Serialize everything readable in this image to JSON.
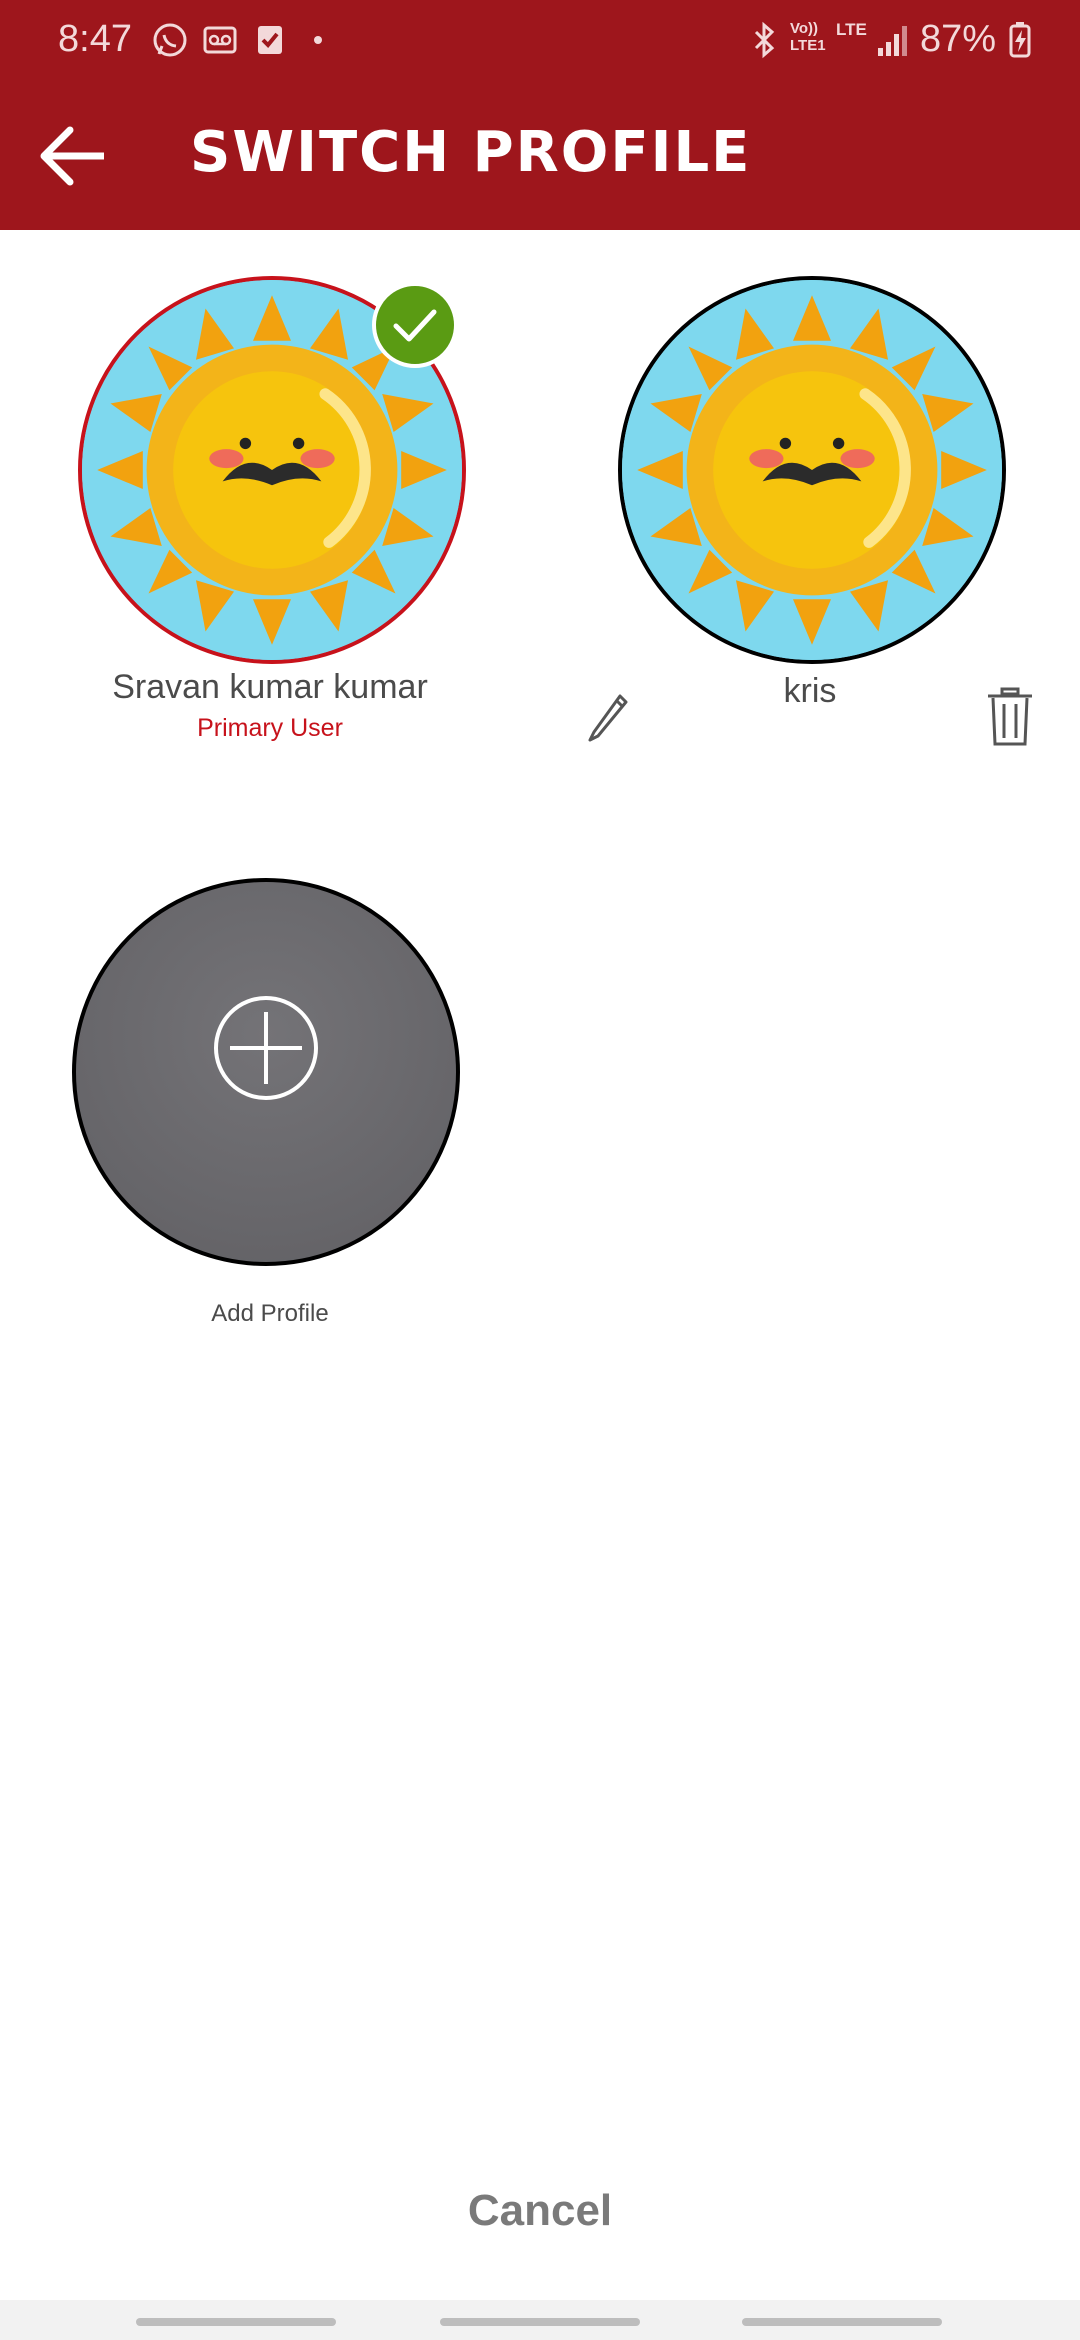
{
  "status_bar": {
    "time": "8:47",
    "battery": "87%",
    "icons": [
      "whatsapp-icon",
      "voicemail-icon",
      "task-check-icon",
      "bluetooth-icon",
      "volte-icon",
      "lte-icon",
      "signal-icon",
      "battery-charging-icon"
    ],
    "volte_text": "Vo)) LTE1",
    "lte_text": "LTE"
  },
  "header": {
    "title": "SWITCH PROFILE",
    "back_icon": "arrow-back-icon"
  },
  "profiles": [
    {
      "name": "Sravan kumar kumar",
      "role": "Primary User",
      "selected": true
    },
    {
      "name": "kris",
      "role": "",
      "selected": false
    }
  ],
  "add_profile": {
    "label": "Add Profile"
  },
  "footer": {
    "cancel_label": "Cancel"
  },
  "colors": {
    "header_bg": "#9e161c",
    "selected_border": "#c7121b",
    "check_badge": "#5a9b13",
    "add_circle": "#6b6a6e"
  }
}
